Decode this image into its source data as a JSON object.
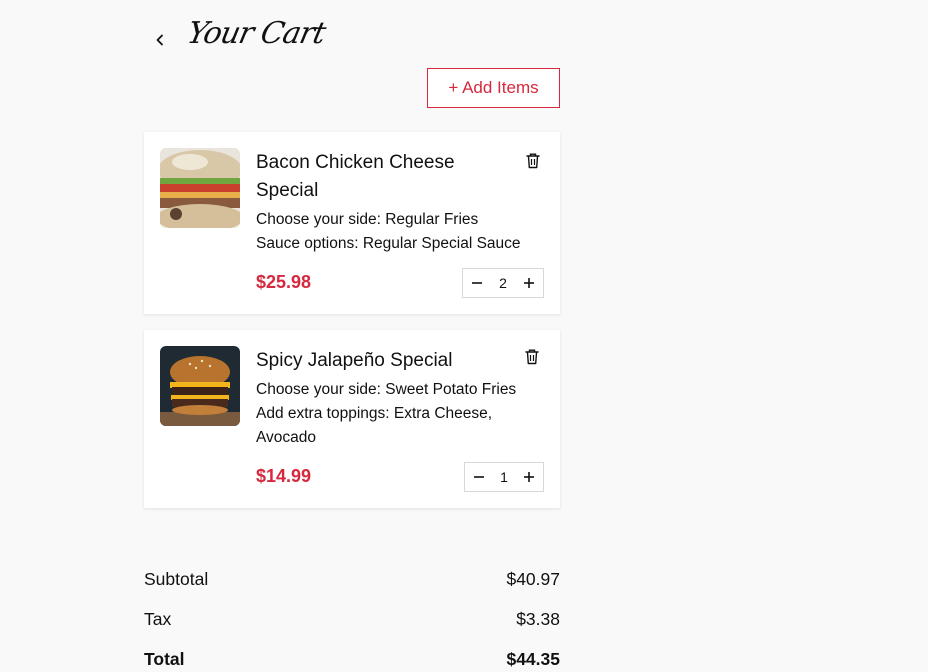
{
  "header": {
    "title": "Your Cart",
    "add_items_label": "+ Add Items"
  },
  "cart": {
    "items": [
      {
        "name": "Bacon Chicken Cheese Special",
        "options": [
          "Choose your side: Regular Fries",
          "Sauce options: Regular Special Sauce"
        ],
        "price": "$25.98",
        "quantity": "2"
      },
      {
        "name": "Spicy Jalapeño Special",
        "options": [
          "Choose your side: Sweet Potato Fries",
          "Add extra toppings: Extra Cheese, Avocado"
        ],
        "price": "$14.99",
        "quantity": "1"
      }
    ]
  },
  "summary": {
    "subtotal_label": "Subtotal",
    "subtotal_value": "$40.97",
    "tax_label": "Tax",
    "tax_value": "$3.38",
    "total_label": "Total",
    "total_value": "$44.35"
  },
  "colors": {
    "accent": "#d6283e",
    "background": "#f9f9f9",
    "card": "#ffffff"
  },
  "icons": [
    "chevron-left-icon",
    "trash-icon",
    "minus-icon",
    "plus-icon"
  ]
}
